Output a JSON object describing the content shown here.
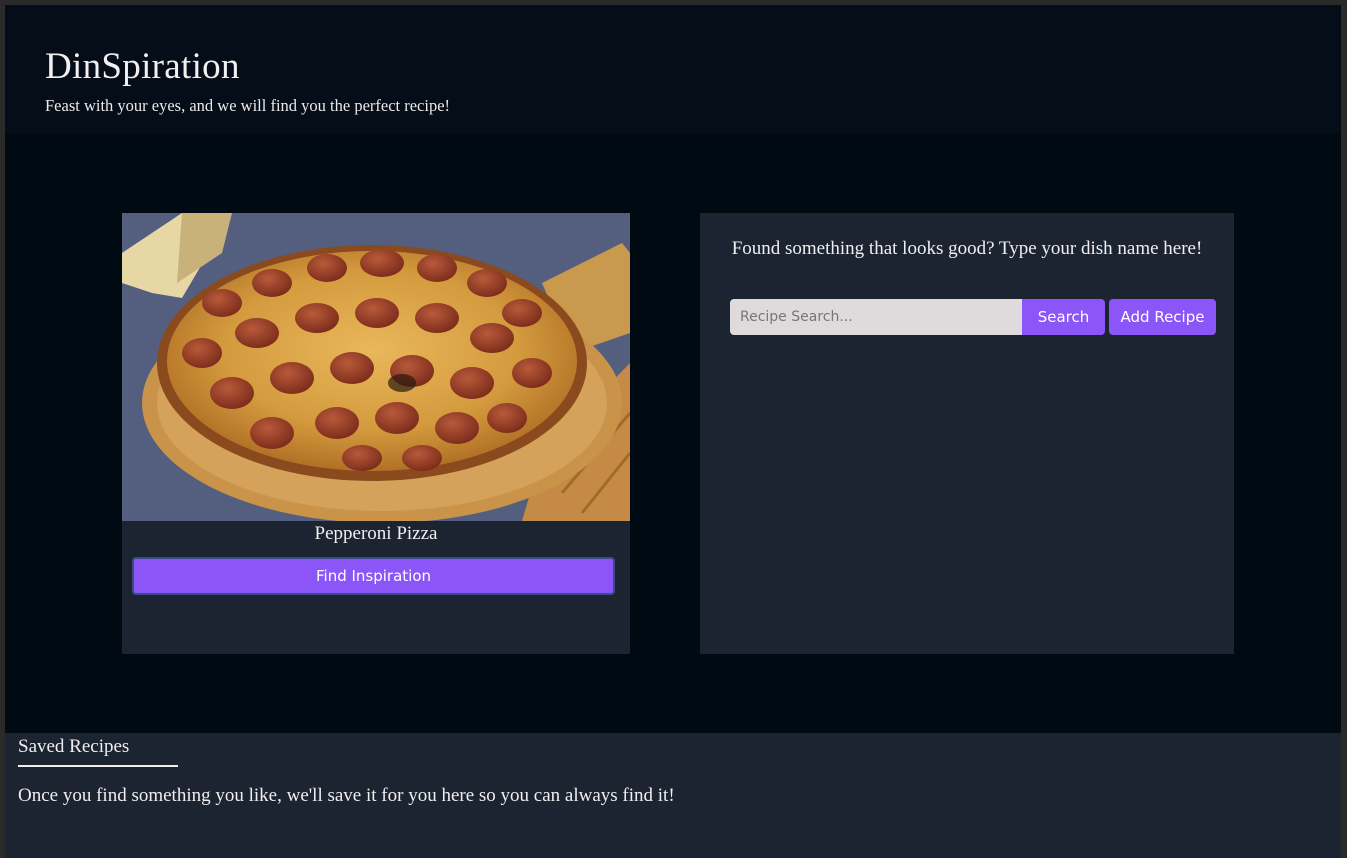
{
  "header": {
    "title": "DinSpiration",
    "subtitle": "Feast with your eyes, and we will find you the perfect recipe!"
  },
  "inspiration_card": {
    "dish_name": "Pepperoni Pizza",
    "find_button_label": "Find Inspiration"
  },
  "search_card": {
    "prompt": "Found something that looks good? Type your dish name here!",
    "search_placeholder": "Recipe Search...",
    "search_value": "",
    "search_button_label": "Search",
    "add_button_label": "Add Recipe"
  },
  "saved_recipes": {
    "title": "Saved Recipes",
    "empty_message": "Once you find something you like, we'll save it for you here so you can always find it!"
  },
  "colors": {
    "accent": "#8b55f8",
    "background": "#000a13",
    "header_bg": "#050d18",
    "card_bg": "#1c2431",
    "text": "#f0eef0"
  }
}
